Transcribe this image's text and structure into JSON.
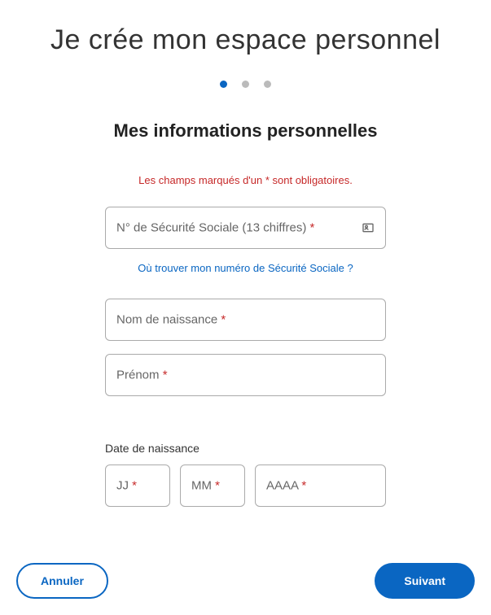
{
  "page_title": "Je crée mon espace personnel",
  "section_title": "Mes informations personnelles",
  "required_notice": "Les champs marqués d'un * sont obligatoires.",
  "stepper": {
    "total": 3,
    "active": 0
  },
  "fields": {
    "ssn": {
      "label": "N° de Sécurité Sociale (13 chiffres) ",
      "value": "",
      "help_link": "Où trouver mon numéro de Sécurité Sociale ?"
    },
    "birth_name": {
      "label": "Nom de naissance ",
      "value": ""
    },
    "first_name": {
      "label": "Prénom ",
      "value": ""
    },
    "birth_date": {
      "label": "Date de naissance",
      "day_label": "JJ ",
      "month_label": "MM ",
      "year_label": "AAAA ",
      "day": "",
      "month": "",
      "year": ""
    }
  },
  "buttons": {
    "cancel": "Annuler",
    "next": "Suivant"
  }
}
